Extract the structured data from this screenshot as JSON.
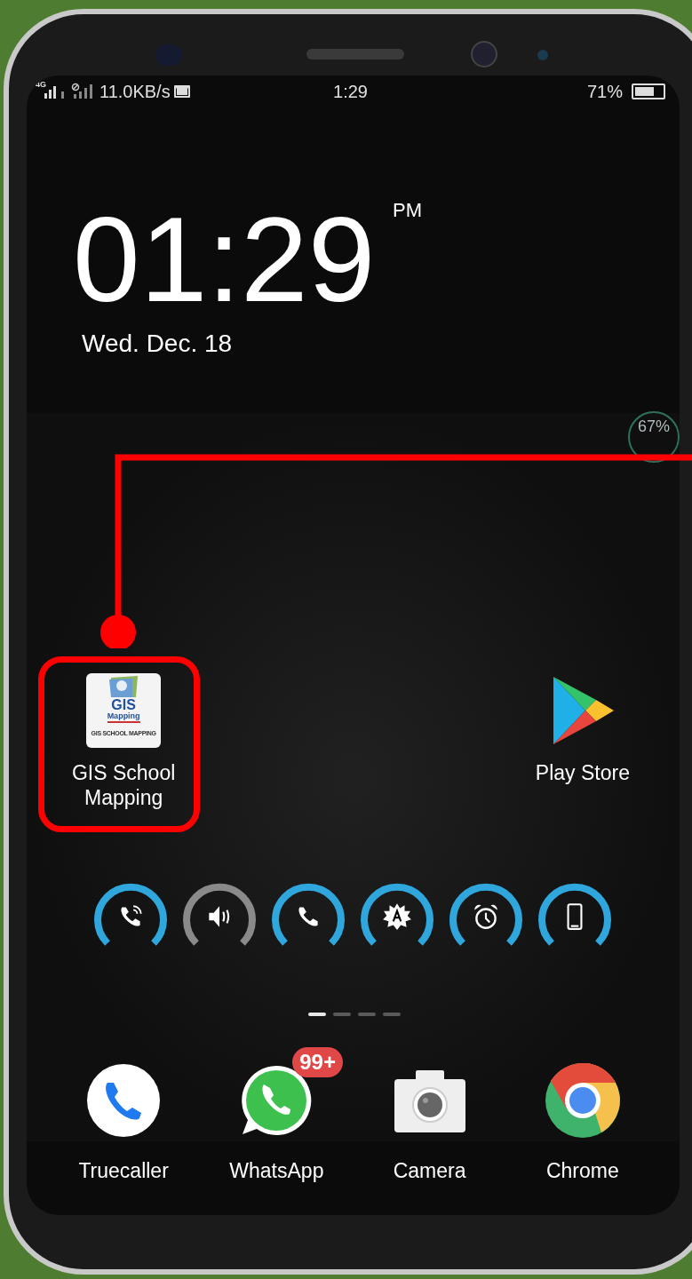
{
  "status_bar": {
    "network": "4G",
    "speed": "11.0KB/s",
    "time": "1:29",
    "battery": "71%"
  },
  "clock": {
    "time": "01:29",
    "ampm": "PM",
    "date": "Wed. Dec. 18"
  },
  "widget": {
    "value": "67%"
  },
  "apps": [
    {
      "kind": "gis",
      "label_lines": [
        "GIS School",
        "Mapping"
      ],
      "icon_text": [
        "GIS",
        "Mapping",
        "GIS SCHOOL MAPPING"
      ],
      "highlighted": true
    },
    {
      "kind": "play",
      "label_lines": [
        "Play Store"
      ],
      "highlighted": false
    }
  ],
  "toggles": [
    {
      "kind": "call-sound",
      "on": true
    },
    {
      "kind": "speaker",
      "on": false
    },
    {
      "kind": "call",
      "on": true
    },
    {
      "kind": "brightness",
      "on": true
    },
    {
      "kind": "alarm",
      "on": true
    },
    {
      "kind": "phone",
      "on": true
    }
  ],
  "pages": [
    {
      "selected": true
    },
    {
      "selected": false
    },
    {
      "selected": false
    },
    {
      "selected": false
    }
  ],
  "dock": [
    {
      "kind": "truecaller",
      "label": "Truecaller"
    },
    {
      "kind": "whatsapp",
      "label": "WhatsApp",
      "badge": "99+"
    },
    {
      "kind": "camera",
      "label": "Camera"
    },
    {
      "kind": "chrome",
      "label": "Chrome"
    }
  ]
}
